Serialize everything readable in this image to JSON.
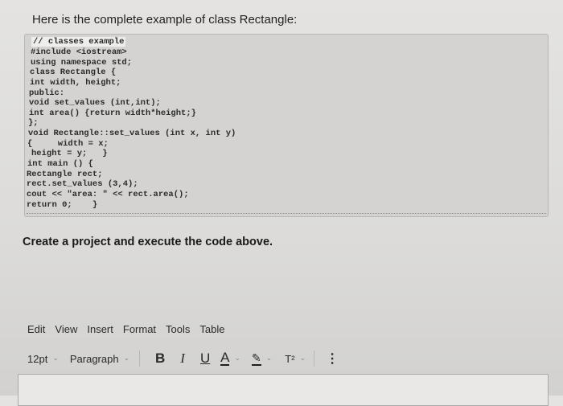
{
  "intro_text": "Here is the complete example of class Rectangle:",
  "code_lines": [
    "// classes example",
    "#include <iostream>",
    "using namespace std;",
    "class Rectangle {",
    "int width, height;",
    "public:",
    "void set_values (int,int);",
    "int area() {return width*height;}",
    "};",
    "void Rectangle::set_values (int x, int y)",
    "{     width = x;",
    "height = y;   }",
    "int main () {",
    "Rectangle rect;",
    "rect.set_values (3,4);",
    "cout << \"area: \" << rect.area();",
    "return 0;    }"
  ],
  "task_text": "Create a project and execute the code above.",
  "menubar": {
    "edit": "Edit",
    "view": "View",
    "insert": "Insert",
    "format": "Format",
    "tools": "Tools",
    "table": "Table"
  },
  "toolbar": {
    "font_size": "12pt",
    "paragraph": "Paragraph",
    "bold": "B",
    "italic": "I",
    "underline": "U",
    "text_color": "A",
    "highlight": "✎",
    "superscript": "T²",
    "more": "⋮"
  },
  "icons": {
    "chevron": "chevron-down-icon"
  }
}
